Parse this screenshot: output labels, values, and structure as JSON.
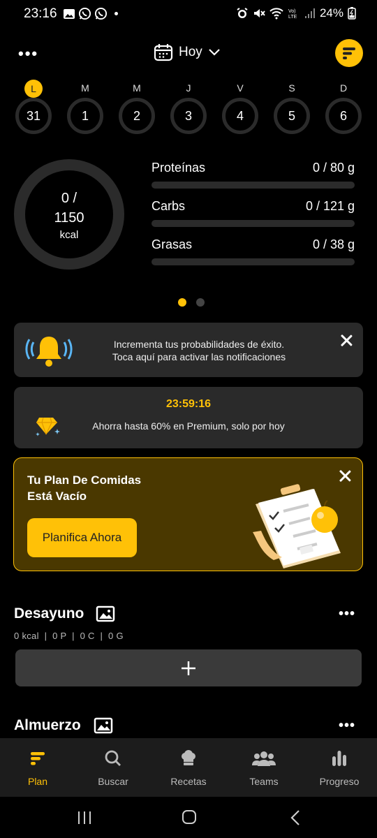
{
  "status_bar": {
    "time": "23:16",
    "battery": "24%"
  },
  "header": {
    "date_label": "Hoy"
  },
  "week": [
    {
      "letter": "L",
      "day": "31",
      "active": true
    },
    {
      "letter": "M",
      "day": "1"
    },
    {
      "letter": "M",
      "day": "2"
    },
    {
      "letter": "J",
      "day": "3"
    },
    {
      "letter": "V",
      "day": "4"
    },
    {
      "letter": "S",
      "day": "5"
    },
    {
      "letter": "D",
      "day": "6"
    }
  ],
  "calories": {
    "consumed": "0 /",
    "target": "1150",
    "unit": "kcal"
  },
  "macros": [
    {
      "label": "Proteínas",
      "value": "0 / 80 g",
      "progress": 0
    },
    {
      "label": "Carbs",
      "value": "0 / 121 g",
      "progress": 0
    },
    {
      "label": "Grasas",
      "value": "0 / 38 g",
      "progress": 0
    }
  ],
  "notification_card": {
    "line1": "Incrementa tus probabilidades de éxito.",
    "line2": "Toca aquí para activar las notificaciones"
  },
  "premium_card": {
    "timer": "23:59:16",
    "text": "Ahorra hasta 60% en Premium, solo por hoy"
  },
  "plan_card": {
    "title_line1": "Tu Plan De Comidas",
    "title_line2": "Está Vacío",
    "button": "Planifica Ahora"
  },
  "meals": [
    {
      "name": "Desayuno",
      "stats": "0 kcal  |  0 P  |  0 C  |  0 G"
    },
    {
      "name": "Almuerzo"
    }
  ],
  "bottom_nav": [
    {
      "label": "Plan",
      "icon": "plan-icon",
      "active": true
    },
    {
      "label": "Buscar",
      "icon": "search-icon"
    },
    {
      "label": "Recetas",
      "icon": "chef-hat-icon"
    },
    {
      "label": "Teams",
      "icon": "teams-icon"
    },
    {
      "label": "Progreso",
      "icon": "bar-chart-icon"
    }
  ],
  "colors": {
    "accent": "#ffc107",
    "background": "#000000",
    "card": "#2a2a2a",
    "track": "#2b2b2b"
  }
}
